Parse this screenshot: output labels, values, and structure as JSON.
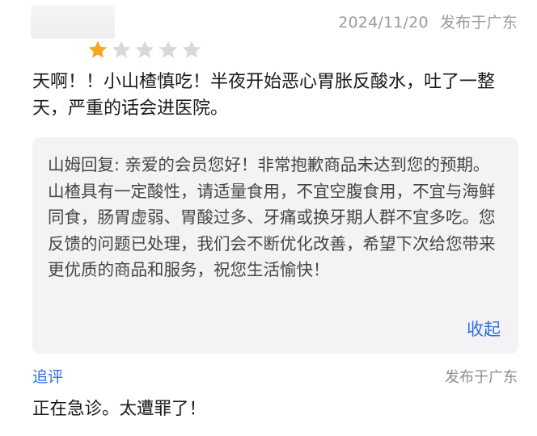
{
  "review": {
    "date": "2024/11/20",
    "location": "发布于广东",
    "rating": 1,
    "rating_max": 5,
    "star_filled_color": "#f5a623",
    "star_empty_color": "#d9d9d9",
    "text": "天啊！！小山楂慎吃！半夜开始恶心胃胀反酸水，吐了一整天，严重的话会进医院。"
  },
  "reply": {
    "text": "山姆回复: 亲爱的会员您好！非常抱歉商品未达到您的预期。山楂具有一定酸性，请适量食用，不宜空腹食用，不宜与海鲜同食，肠胃虚弱、胃酸过多、牙痛或换牙期人群不宜多吃。您反馈的问题已处理，我们会不断优化改善，希望下次给您带来更优质的商品和服务，祝您生活愉快！",
    "collapse_label": "收起"
  },
  "followup": {
    "label": "追评",
    "location": "发布于广东",
    "text": "正在急诊。太遭罪了！"
  },
  "colors": {
    "link": "#2f6ee0",
    "reply_bg": "#f3f3f5"
  }
}
